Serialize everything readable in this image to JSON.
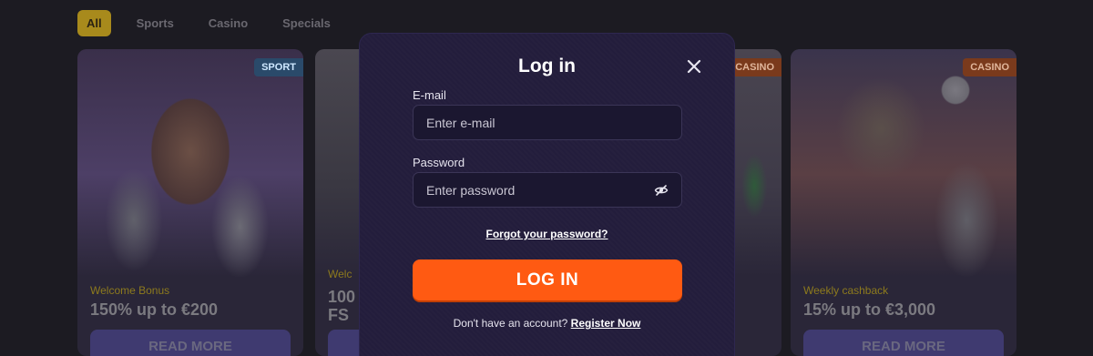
{
  "filters": [
    "All",
    "Sports",
    "Casino",
    "Specials"
  ],
  "promos": [
    {
      "badge": "SPORT",
      "label": "Welcome Bonus",
      "title": "150% up to €200",
      "button": "READ MORE"
    },
    {
      "badge": "",
      "label": "Welc",
      "title_line1": "100",
      "title_line2": "FS",
      "button": "READ MORE"
    },
    {
      "badge": "CASINO",
      "label": "",
      "title": "",
      "button": ""
    },
    {
      "badge": "CASINO",
      "label": "Weekly cashback",
      "title": "15% up to €3,000",
      "button": "READ MORE"
    }
  ],
  "login_modal": {
    "title": "Log in",
    "email_label": "E-mail",
    "email_placeholder": "Enter e-mail",
    "password_label": "Password",
    "password_placeholder": "Enter password",
    "forgot_link": "Forgot your password?",
    "login_button": "LOG IN",
    "signup_prompt": "Don't have an account?",
    "register_link": "Register Now"
  },
  "colors": {
    "accent": "#ff5a12",
    "modal_bg": "#231d3c",
    "overlay_bg": "#1c1b22"
  }
}
